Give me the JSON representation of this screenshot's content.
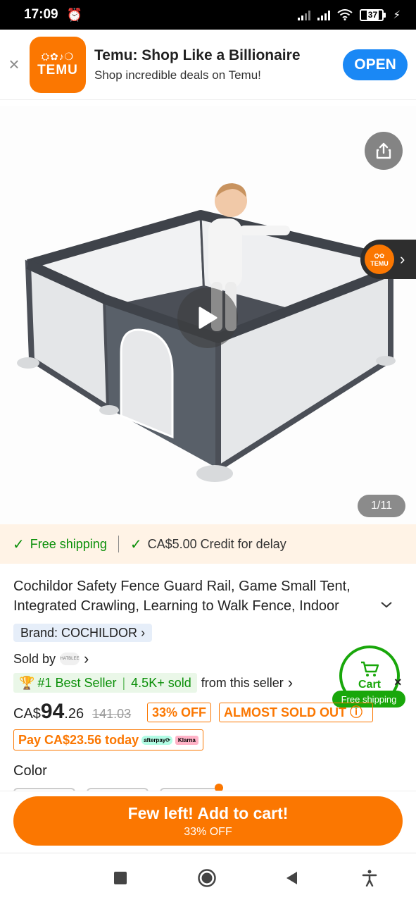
{
  "status_bar": {
    "time": "17:09",
    "battery": "37"
  },
  "banner": {
    "close": "×",
    "logo_glyphs": "⛭✿♪❍",
    "logo_word": "TEMU",
    "title": "Temu: Shop Like a Billionaire",
    "subtitle": "Shop incredible deals on Temu!",
    "open_label": "OPEN"
  },
  "gallery": {
    "counter": "1/11",
    "store_badge": "TEMU"
  },
  "shipping": {
    "free": "Free shipping",
    "credit": "CA$5.00 Credit for delay"
  },
  "product": {
    "title": "Cochildor Safety Fence Guard Rail, Game Small Tent, Integrated Crawling, Learning to Walk Fence, Indoor",
    "brand": "Brand: COCHILDOR",
    "sold_by": "Sold by",
    "seller_logo": "HATBLEE",
    "best_seller": "#1 Best Seller",
    "sold_count": "4.5K+ sold",
    "from_seller": "from this seller",
    "price_currency": "CA$",
    "price_int": "94",
    "price_dec": ".26",
    "price_old": "141.03",
    "discount": "33% OFF",
    "almost_sold": "ALMOST SOLD OUT",
    "pay_today": "Pay CA$23.56 today",
    "afterpay": "afterpay⟳",
    "klarna": "Klarna",
    "color_label": "Color"
  },
  "cart_fab": {
    "label": "Cart",
    "badge": "Free shipping"
  },
  "cta": {
    "line1": "Few left! Add to cart!",
    "line2": "33% OFF"
  },
  "colors": {
    "accent": "#fb7701",
    "green": "#19a70b",
    "blue": "#1a88f5"
  }
}
